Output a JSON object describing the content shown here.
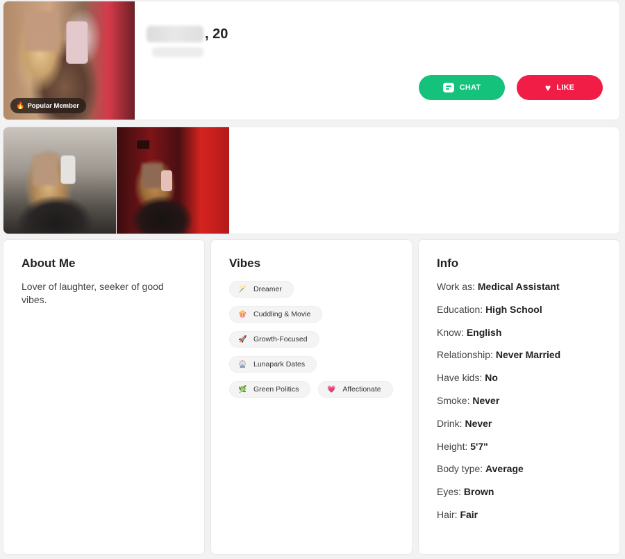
{
  "profile": {
    "age": ", 20",
    "badge": "Popular Member"
  },
  "actions": {
    "chat_label": "CHAT",
    "like_label": "LIKE"
  },
  "about": {
    "title": "About Me",
    "text": "Lover of laughter, seeker of good vibes."
  },
  "vibes": {
    "title": "Vibes",
    "items": [
      {
        "emoji": "🪄",
        "icon": "magic-wand-icon",
        "label": "Dreamer"
      },
      {
        "emoji": "🍿",
        "icon": "popcorn-icon",
        "label": "Cuddling & Movie"
      },
      {
        "emoji": "🚀",
        "icon": "rocket-icon",
        "label": "Growth-Focused"
      },
      {
        "emoji": "🎡",
        "icon": "ferris-wheel-icon",
        "label": "Lunapark Dates"
      },
      {
        "emoji": "🌿",
        "icon": "leaf-icon",
        "label": "Green Politics"
      },
      {
        "emoji": "💗",
        "icon": "heart-icon",
        "label": "Affectionate"
      }
    ]
  },
  "info": {
    "title": "Info",
    "rows": [
      {
        "label": "Work as:",
        "value": "Medical Assistant"
      },
      {
        "label": "Education:",
        "value": "High School"
      },
      {
        "label": "Know:",
        "value": "English"
      },
      {
        "label": "Relationship:",
        "value": "Never Married"
      },
      {
        "label": "Have kids:",
        "value": "No"
      },
      {
        "label": "Smoke:",
        "value": "Never"
      },
      {
        "label": "Drink:",
        "value": "Never"
      },
      {
        "label": "Height:",
        "value": "5'7\""
      },
      {
        "label": "Body type:",
        "value": "Average"
      },
      {
        "label": "Eyes:",
        "value": "Brown"
      },
      {
        "label": "Hair:",
        "value": "Fair"
      }
    ]
  },
  "colors": {
    "chat": "#15c27b",
    "like": "#f21d47",
    "background": "#f2f2f2"
  }
}
